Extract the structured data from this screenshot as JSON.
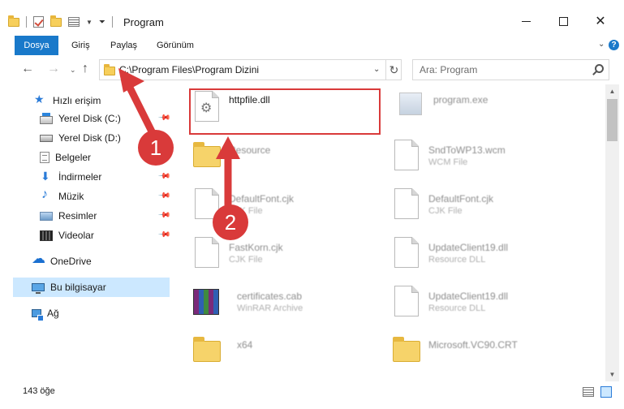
{
  "window": {
    "title": "Program",
    "minimize_label": "",
    "maximize_label": "",
    "close_glyph": "✕"
  },
  "ribbon": {
    "tabs": [
      "Dosya",
      "Giriş",
      "Paylaş",
      "Görünüm"
    ],
    "expand_glyph": "⌄",
    "help_glyph": "?"
  },
  "nav": {
    "back_glyph": "←",
    "forward_glyph": "→",
    "recent_glyph": "⌄",
    "up_glyph": "↑"
  },
  "address": {
    "path": "C:\\Program Files\\Program Dizini",
    "dropdown_glyph": "⌄",
    "refresh_glyph": "↻"
  },
  "search": {
    "placeholder": "Ara: Program"
  },
  "sidebar": {
    "items": [
      {
        "label": "Hızlı erişim",
        "icon": "star-icon"
      },
      {
        "label": "Yerel Disk (C:)",
        "icon": "drive-icon",
        "pinned": true
      },
      {
        "label": "Yerel Disk (D:)",
        "icon": "drive-icon",
        "pinned": false
      },
      {
        "label": "Belgeler",
        "icon": "documents-icon",
        "pinned": true
      },
      {
        "label": "İndirmeler",
        "icon": "downloads-icon",
        "pinned": true
      },
      {
        "label": "Müzik",
        "icon": "music-icon",
        "pinned": true
      },
      {
        "label": "Resimler",
        "icon": "pictures-icon",
        "pinned": true
      },
      {
        "label": "Videolar",
        "icon": "videos-icon",
        "pinned": true
      },
      {
        "label": "OneDrive",
        "icon": "cloud-icon"
      },
      {
        "label": "Bu bilgisayar",
        "icon": "computer-icon"
      },
      {
        "label": "Ağ",
        "icon": "network-icon"
      }
    ],
    "pin_glyph": "📌"
  },
  "files": [
    {
      "name": "httpfile.dll",
      "type": "",
      "icon": "dll-file-icon"
    },
    {
      "name": "program.exe",
      "type": "",
      "icon": "exe-file-icon"
    },
    {
      "name": "Resource",
      "type": "",
      "icon": "folder-icon"
    },
    {
      "name": "SndToWP13.wcm",
      "type": "WCM File",
      "icon": "file-icon"
    },
    {
      "name": "DefaultFont.cjk",
      "type": "CJK File",
      "icon": "file-icon"
    },
    {
      "name": "DefaultFont.cjk",
      "type": "CJK File",
      "icon": "file-icon"
    },
    {
      "name": "FastKorn.cjk",
      "type": "CJK File",
      "icon": "file-icon"
    },
    {
      "name": "UpdateClient19.dll",
      "type": "Resource DLL",
      "icon": "dll-file-icon"
    },
    {
      "name": "certificates.cab",
      "type": "WinRAR Archive",
      "icon": "archive-icon"
    },
    {
      "name": "UpdateClient19.dll",
      "type": "Resource DLL",
      "icon": "dll-file-icon"
    },
    {
      "name": "x64",
      "type": "",
      "icon": "folder-icon"
    },
    {
      "name": "Microsoft.VC90.CRT",
      "type": "",
      "icon": "folder-icon"
    }
  ],
  "status": {
    "item_count": "143 öğe"
  },
  "annotations": {
    "step1": "1",
    "step2": "2",
    "color": "#d93a3a"
  },
  "colors": {
    "accent": "#1979ca",
    "selection": "#cce8ff"
  }
}
